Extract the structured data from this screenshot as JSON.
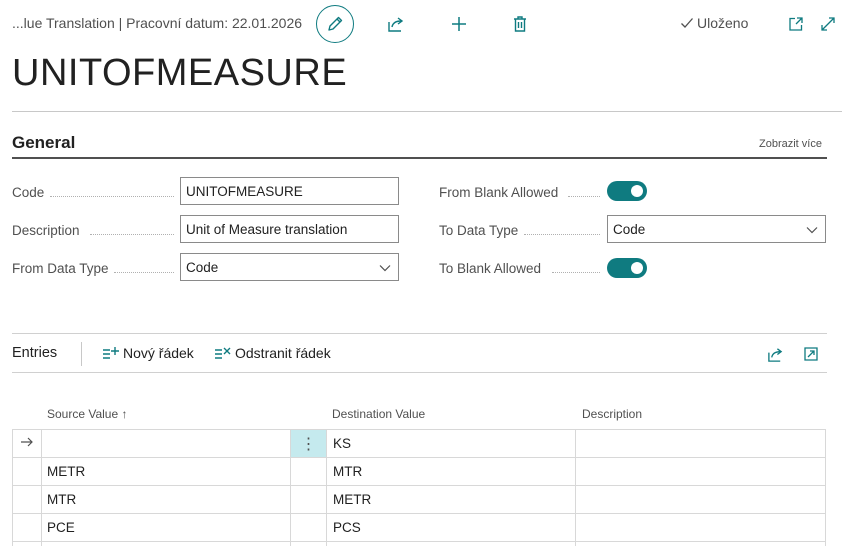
{
  "header": {
    "breadcrumb": "...lue Translation | Pracovní datum: 22.01.2026",
    "saved_label": "Uloženo",
    "icons": [
      "pencil-icon",
      "share-icon",
      "plus-icon",
      "trash-icon",
      "check-icon",
      "open-new-window-icon",
      "expand-icon"
    ]
  },
  "page": {
    "title": "UNITOFMEASURE"
  },
  "general": {
    "title": "General",
    "show_more": "Zobrazit více",
    "fields": {
      "code": {
        "label": "Code",
        "value": "UNITOFMEASURE"
      },
      "description": {
        "label": "Description",
        "value": "Unit of Measure translation"
      },
      "from_data_type": {
        "label": "From Data Type",
        "value": "Code"
      },
      "from_blank_allowed": {
        "label": "From Blank Allowed",
        "value": true
      },
      "to_data_type": {
        "label": "To Data Type",
        "value": "Code"
      },
      "to_blank_allowed": {
        "label": "To Blank Allowed",
        "value": true
      }
    }
  },
  "entries": {
    "title": "Entries",
    "new_line": "Nový řádek",
    "delete_line": "Odstranit řádek",
    "columns": [
      "Source Value ↑",
      "Destination Value",
      "Description"
    ],
    "rows": [
      {
        "source": "",
        "destination": "KS",
        "description": ""
      },
      {
        "source": "METR",
        "destination": "MTR",
        "description": ""
      },
      {
        "source": "MTR",
        "destination": "METR",
        "description": ""
      },
      {
        "source": "PCE",
        "destination": "PCS",
        "description": ""
      }
    ]
  },
  "colors": {
    "accent": "#0f7b80",
    "selected_cell": "#c5eaee"
  }
}
